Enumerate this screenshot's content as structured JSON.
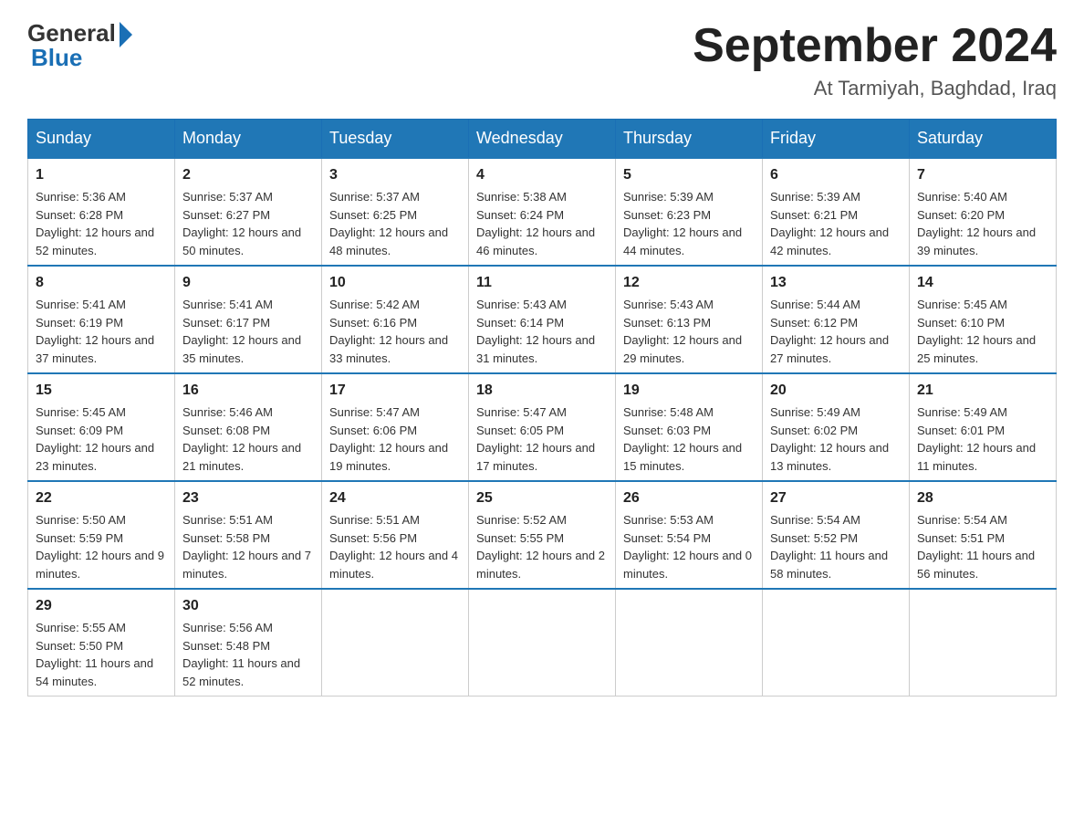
{
  "header": {
    "logo_general": "General",
    "logo_blue": "Blue",
    "title": "September 2024",
    "location": "At Tarmiyah, Baghdad, Iraq"
  },
  "days_of_week": [
    "Sunday",
    "Monday",
    "Tuesday",
    "Wednesday",
    "Thursday",
    "Friday",
    "Saturday"
  ],
  "weeks": [
    [
      {
        "day": "1",
        "sunrise": "Sunrise: 5:36 AM",
        "sunset": "Sunset: 6:28 PM",
        "daylight": "Daylight: 12 hours and 52 minutes."
      },
      {
        "day": "2",
        "sunrise": "Sunrise: 5:37 AM",
        "sunset": "Sunset: 6:27 PM",
        "daylight": "Daylight: 12 hours and 50 minutes."
      },
      {
        "day": "3",
        "sunrise": "Sunrise: 5:37 AM",
        "sunset": "Sunset: 6:25 PM",
        "daylight": "Daylight: 12 hours and 48 minutes."
      },
      {
        "day": "4",
        "sunrise": "Sunrise: 5:38 AM",
        "sunset": "Sunset: 6:24 PM",
        "daylight": "Daylight: 12 hours and 46 minutes."
      },
      {
        "day": "5",
        "sunrise": "Sunrise: 5:39 AM",
        "sunset": "Sunset: 6:23 PM",
        "daylight": "Daylight: 12 hours and 44 minutes."
      },
      {
        "day": "6",
        "sunrise": "Sunrise: 5:39 AM",
        "sunset": "Sunset: 6:21 PM",
        "daylight": "Daylight: 12 hours and 42 minutes."
      },
      {
        "day": "7",
        "sunrise": "Sunrise: 5:40 AM",
        "sunset": "Sunset: 6:20 PM",
        "daylight": "Daylight: 12 hours and 39 minutes."
      }
    ],
    [
      {
        "day": "8",
        "sunrise": "Sunrise: 5:41 AM",
        "sunset": "Sunset: 6:19 PM",
        "daylight": "Daylight: 12 hours and 37 minutes."
      },
      {
        "day": "9",
        "sunrise": "Sunrise: 5:41 AM",
        "sunset": "Sunset: 6:17 PM",
        "daylight": "Daylight: 12 hours and 35 minutes."
      },
      {
        "day": "10",
        "sunrise": "Sunrise: 5:42 AM",
        "sunset": "Sunset: 6:16 PM",
        "daylight": "Daylight: 12 hours and 33 minutes."
      },
      {
        "day": "11",
        "sunrise": "Sunrise: 5:43 AM",
        "sunset": "Sunset: 6:14 PM",
        "daylight": "Daylight: 12 hours and 31 minutes."
      },
      {
        "day": "12",
        "sunrise": "Sunrise: 5:43 AM",
        "sunset": "Sunset: 6:13 PM",
        "daylight": "Daylight: 12 hours and 29 minutes."
      },
      {
        "day": "13",
        "sunrise": "Sunrise: 5:44 AM",
        "sunset": "Sunset: 6:12 PM",
        "daylight": "Daylight: 12 hours and 27 minutes."
      },
      {
        "day": "14",
        "sunrise": "Sunrise: 5:45 AM",
        "sunset": "Sunset: 6:10 PM",
        "daylight": "Daylight: 12 hours and 25 minutes."
      }
    ],
    [
      {
        "day": "15",
        "sunrise": "Sunrise: 5:45 AM",
        "sunset": "Sunset: 6:09 PM",
        "daylight": "Daylight: 12 hours and 23 minutes."
      },
      {
        "day": "16",
        "sunrise": "Sunrise: 5:46 AM",
        "sunset": "Sunset: 6:08 PM",
        "daylight": "Daylight: 12 hours and 21 minutes."
      },
      {
        "day": "17",
        "sunrise": "Sunrise: 5:47 AM",
        "sunset": "Sunset: 6:06 PM",
        "daylight": "Daylight: 12 hours and 19 minutes."
      },
      {
        "day": "18",
        "sunrise": "Sunrise: 5:47 AM",
        "sunset": "Sunset: 6:05 PM",
        "daylight": "Daylight: 12 hours and 17 minutes."
      },
      {
        "day": "19",
        "sunrise": "Sunrise: 5:48 AM",
        "sunset": "Sunset: 6:03 PM",
        "daylight": "Daylight: 12 hours and 15 minutes."
      },
      {
        "day": "20",
        "sunrise": "Sunrise: 5:49 AM",
        "sunset": "Sunset: 6:02 PM",
        "daylight": "Daylight: 12 hours and 13 minutes."
      },
      {
        "day": "21",
        "sunrise": "Sunrise: 5:49 AM",
        "sunset": "Sunset: 6:01 PM",
        "daylight": "Daylight: 12 hours and 11 minutes."
      }
    ],
    [
      {
        "day": "22",
        "sunrise": "Sunrise: 5:50 AM",
        "sunset": "Sunset: 5:59 PM",
        "daylight": "Daylight: 12 hours and 9 minutes."
      },
      {
        "day": "23",
        "sunrise": "Sunrise: 5:51 AM",
        "sunset": "Sunset: 5:58 PM",
        "daylight": "Daylight: 12 hours and 7 minutes."
      },
      {
        "day": "24",
        "sunrise": "Sunrise: 5:51 AM",
        "sunset": "Sunset: 5:56 PM",
        "daylight": "Daylight: 12 hours and 4 minutes."
      },
      {
        "day": "25",
        "sunrise": "Sunrise: 5:52 AM",
        "sunset": "Sunset: 5:55 PM",
        "daylight": "Daylight: 12 hours and 2 minutes."
      },
      {
        "day": "26",
        "sunrise": "Sunrise: 5:53 AM",
        "sunset": "Sunset: 5:54 PM",
        "daylight": "Daylight: 12 hours and 0 minutes."
      },
      {
        "day": "27",
        "sunrise": "Sunrise: 5:54 AM",
        "sunset": "Sunset: 5:52 PM",
        "daylight": "Daylight: 11 hours and 58 minutes."
      },
      {
        "day": "28",
        "sunrise": "Sunrise: 5:54 AM",
        "sunset": "Sunset: 5:51 PM",
        "daylight": "Daylight: 11 hours and 56 minutes."
      }
    ],
    [
      {
        "day": "29",
        "sunrise": "Sunrise: 5:55 AM",
        "sunset": "Sunset: 5:50 PM",
        "daylight": "Daylight: 11 hours and 54 minutes."
      },
      {
        "day": "30",
        "sunrise": "Sunrise: 5:56 AM",
        "sunset": "Sunset: 5:48 PM",
        "daylight": "Daylight: 11 hours and 52 minutes."
      },
      null,
      null,
      null,
      null,
      null
    ]
  ]
}
